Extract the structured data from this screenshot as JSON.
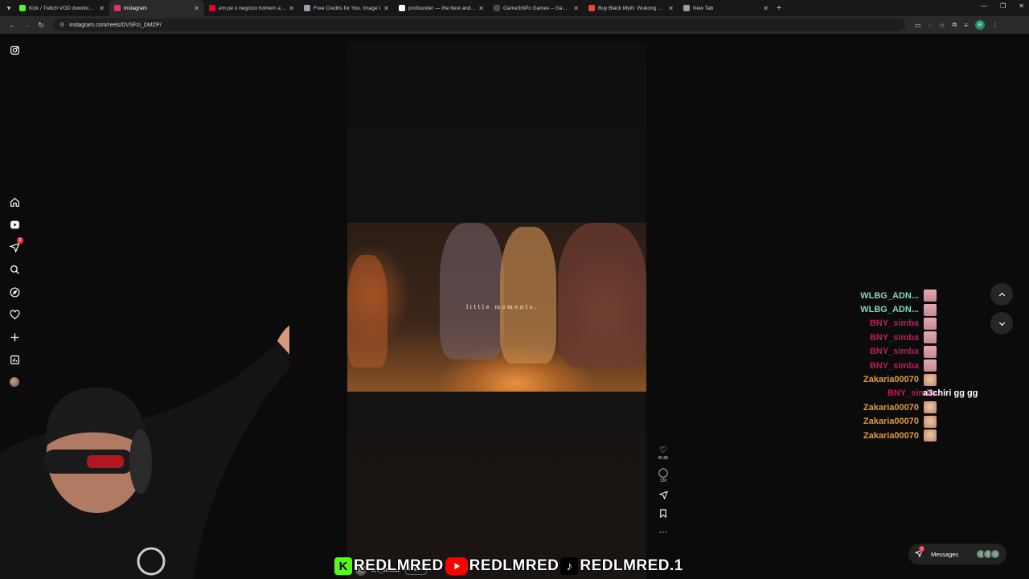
{
  "browser": {
    "tabs": [
      {
        "title": "Kick / Twitch VOD downloader",
        "color": "#53fc18"
      },
      {
        "title": "Instagram",
        "color": "#e1306c",
        "active": true
      },
      {
        "title": "em pé o negócio homem apon",
        "color": "#e60023"
      },
      {
        "title": "Free Credits for You. Image I",
        "color": "#9aa0a6"
      },
      {
        "title": "profounder — the best and fre",
        "color": "#ffffff"
      },
      {
        "title": "Game3rbPc Games – Games O",
        "color": "#4a4a4a"
      },
      {
        "title": "Buy Black Myth: Wukong Acco",
        "color": "#e8453c"
      },
      {
        "title": "New Tab",
        "color": "#9aa0a6"
      }
    ],
    "url": "instagram.com/reels/DVSFzi_DMZP/",
    "profile_initial": "R"
  },
  "reel": {
    "overlay_text": "little moments.",
    "author": "bihi_official1",
    "follow_label": "Follow",
    "likes": "45.8K",
    "comments": "130"
  },
  "chat": [
    {
      "user": "WLBG_ADN...",
      "color": "#7fd6c0",
      "emote": "pink",
      "msg": ""
    },
    {
      "user": "WLBG_ADN...",
      "color": "#7fd6c0",
      "emote": "pink",
      "msg": ""
    },
    {
      "user": "BNY_simba",
      "color": "#c2185b",
      "emote": "pink",
      "msg": ""
    },
    {
      "user": "BNY_simba",
      "color": "#c2185b",
      "emote": "pink",
      "msg": ""
    },
    {
      "user": "BNY_simba",
      "color": "#c2185b",
      "emote": "pink",
      "msg": ""
    },
    {
      "user": "BNY_simba",
      "color": "#c2185b",
      "emote": "pink",
      "msg": ""
    },
    {
      "user": "Zakaria00070",
      "color": "#e39a3b",
      "emote": "face",
      "msg": ""
    },
    {
      "user": "BNY_simba",
      "color": "#c2185b",
      "emote": "none",
      "msg": "a3chiri gg gg"
    },
    {
      "user": "Zakaria00070",
      "color": "#e39a3b",
      "emote": "face",
      "msg": ""
    },
    {
      "user": "Zakaria00070",
      "color": "#e39a3b",
      "emote": "face",
      "msg": ""
    },
    {
      "user": "Zakaria00070",
      "color": "#e39a3b",
      "emote": "face",
      "msg": ""
    }
  ],
  "sidebar": {
    "notification_badge": "2"
  },
  "messages": {
    "label": "Messages",
    "badge": "2"
  },
  "banner": {
    "kick_name": "REDLMRED",
    "youtube_name": "REDLMRED",
    "tiktok_name": "REDLMRED.1",
    "kick_color": "#53fc18",
    "youtube_color": "#ff0000",
    "tiktok_color": "#000000"
  }
}
